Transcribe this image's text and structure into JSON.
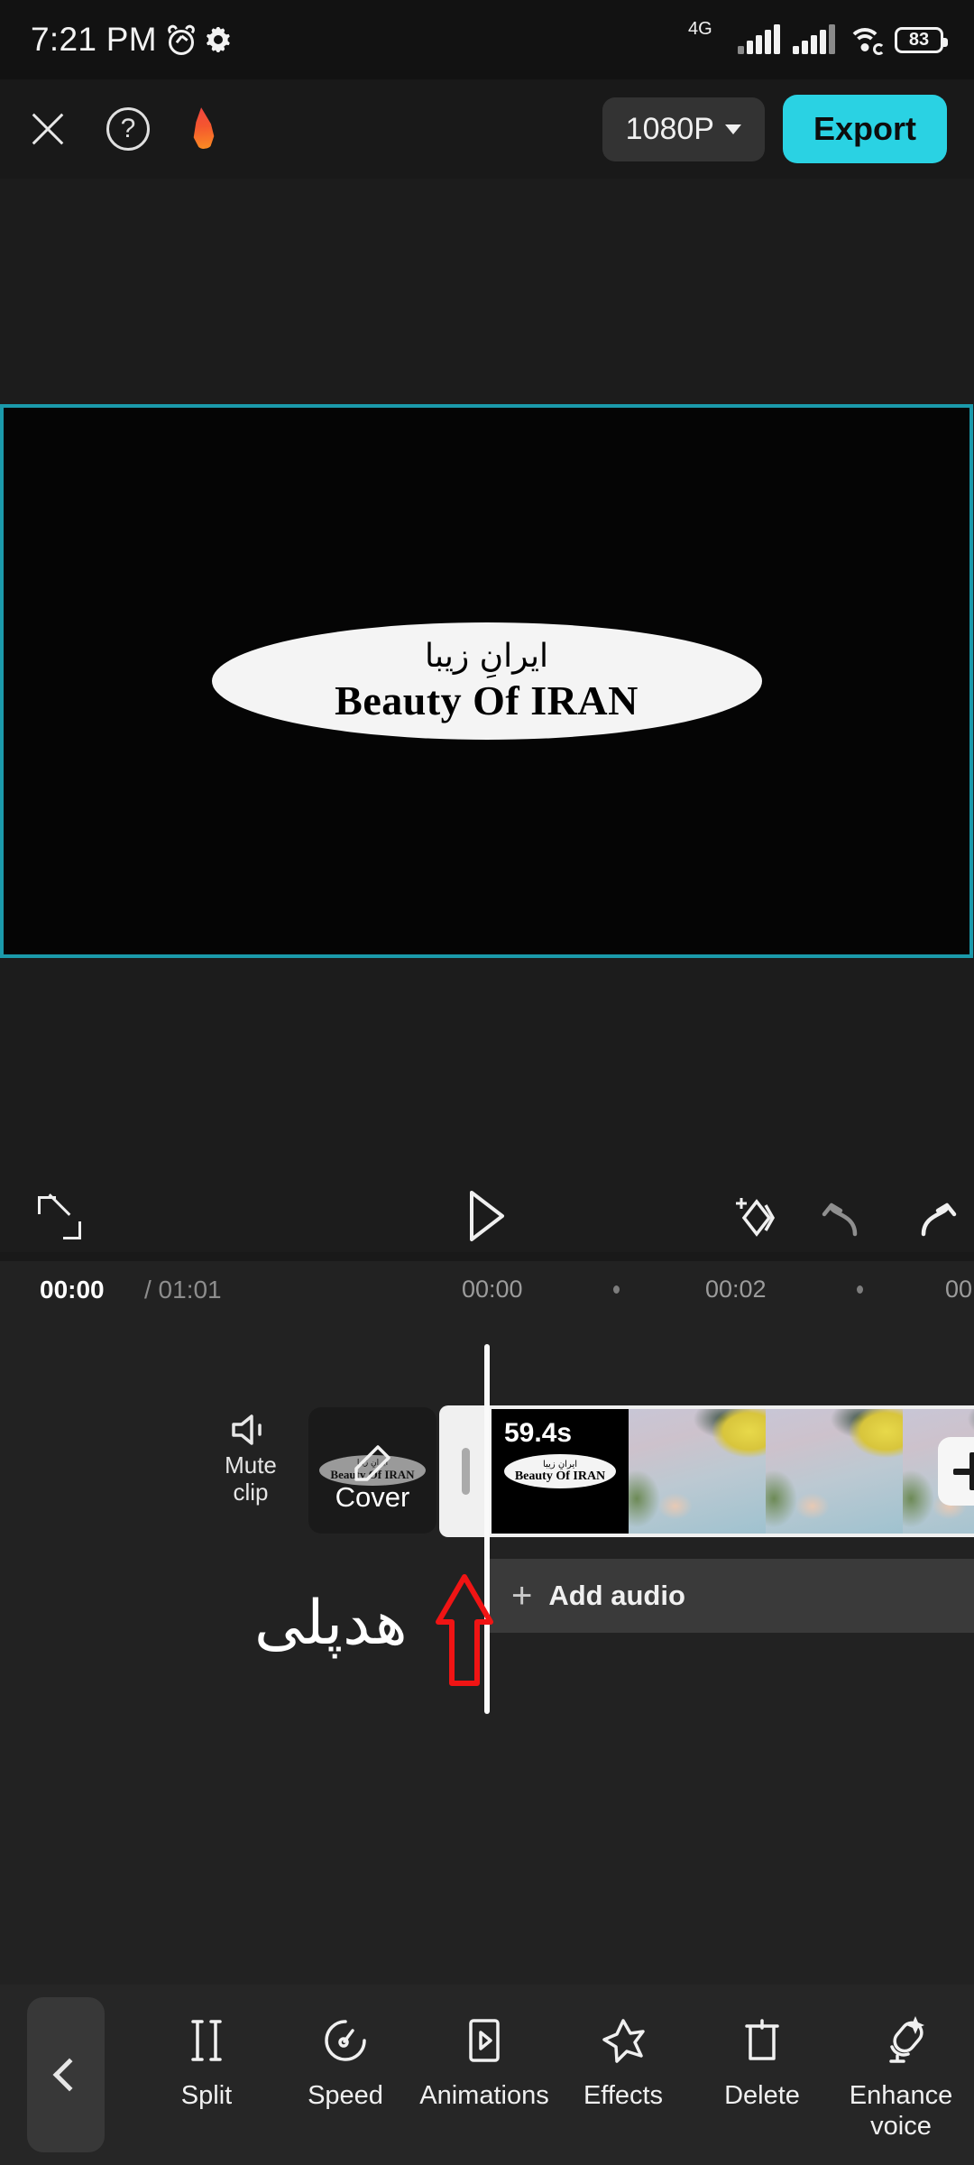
{
  "statusbar": {
    "time": "7:21 PM",
    "alarm_icon": "alarm-icon",
    "gear_icon": "gear-icon",
    "network_type": "4G",
    "wifi_icon": "wifi-icon",
    "battery_level": "83"
  },
  "toolbar": {
    "close_icon": "close-icon",
    "help_icon": "help-icon",
    "flame_icon": "flame-icon",
    "resolution_label": "1080P",
    "resolution_caret": "chevron-down-icon",
    "export_label": "Export",
    "export_color": "#2ad2e3"
  },
  "preview": {
    "border_color": "#1b9aab",
    "title_fa": "ایرانِ زیبا",
    "title_en": "Beauty Of IRAN"
  },
  "player": {
    "expand_icon": "fullscreen-icon",
    "play_icon": "play-icon",
    "keyframe_icon": "add-keyframe-icon",
    "undo_icon": "undo-icon",
    "redo_icon": "redo-icon"
  },
  "timeline": {
    "current_time": "00:00",
    "total_time": "/ 01:01",
    "ticks": [
      "00:00",
      "00:02",
      "00"
    ],
    "mute_label_line1": "Mute",
    "mute_label_line2": "clip",
    "mute_icon": "speaker-icon",
    "cover_label": "Cover",
    "cover_pencil_icon": "pencil-icon",
    "cover_thumb_fa": "ایرانِ زیبا",
    "cover_thumb_en": "Beauty Of IRAN",
    "clip_duration": "59.4s",
    "clip_thumb_fa": "ایرانِ زیبا",
    "clip_thumb_en": "Beauty Of IRAN",
    "add_clip_icon": "plus-icon",
    "trim_handle": "trim-handle",
    "playhead": "playhead",
    "add_audio_plus": "+",
    "add_audio_label": "Add audio"
  },
  "annotation": {
    "text_fa": "هدپلی",
    "arrow_icon": "up-arrow-icon",
    "arrow_color": "#f01414"
  },
  "bottombar": {
    "back_icon": "chevron-left-icon",
    "tools": [
      {
        "label": "Split",
        "icon": "split-icon"
      },
      {
        "label": "Speed",
        "icon": "speed-icon"
      },
      {
        "label": "Animations",
        "icon": "animations-icon"
      },
      {
        "label": "Effects",
        "icon": "effects-star-icon"
      },
      {
        "label": "Delete",
        "icon": "trash-icon"
      },
      {
        "label": "Enhance voice",
        "icon": "enhance-voice-icon"
      }
    ]
  }
}
